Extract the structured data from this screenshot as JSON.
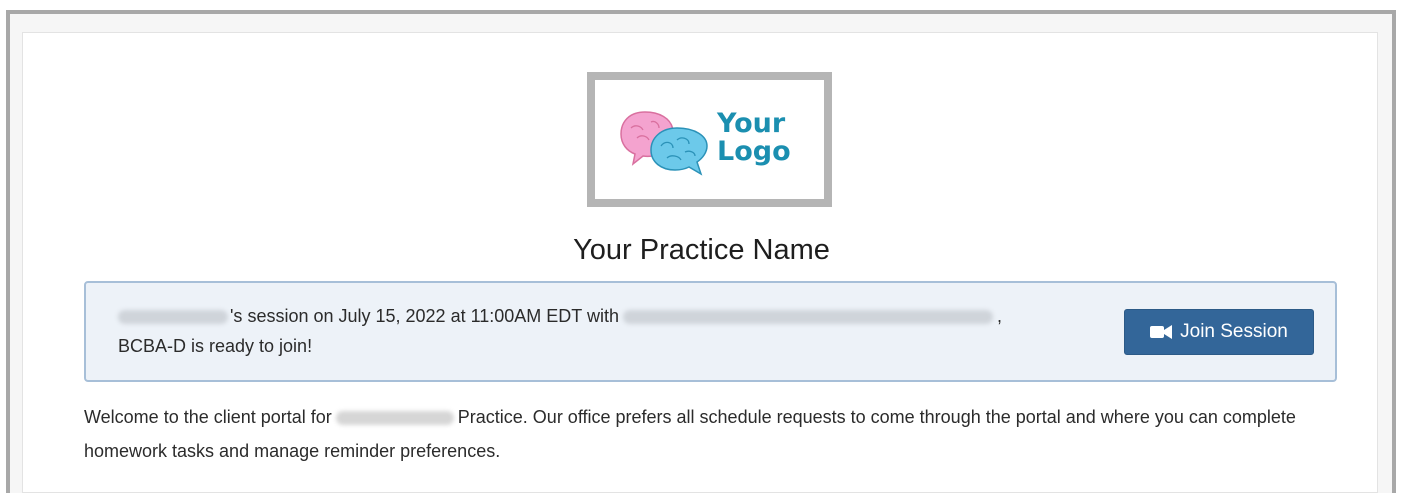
{
  "logo": {
    "text": "Your\nLogo",
    "icon": "brain-speech-bubbles",
    "colors": {
      "text": "#1b8fb0",
      "pink": "#f4a3cf",
      "blue": "#6cc9ea"
    }
  },
  "practice": {
    "name": "Your Practice Name"
  },
  "session": {
    "text_1": "'s session on July 15, 2022 at 11:00AM EDT with",
    "text_2": ",",
    "text_3": "BCBA-D is ready to join!",
    "join_label": "Join Session",
    "join_icon": "video-camera-icon",
    "colors": {
      "button": "#336699",
      "banner": "#edf2f8",
      "border": "#a7bfd8"
    }
  },
  "welcome": {
    "text_1": "Welcome to the client portal for",
    "text_2": "Practice. Our office prefers all schedule requests to come through the portal and where you can complete homework tasks and manage reminder preferences."
  }
}
